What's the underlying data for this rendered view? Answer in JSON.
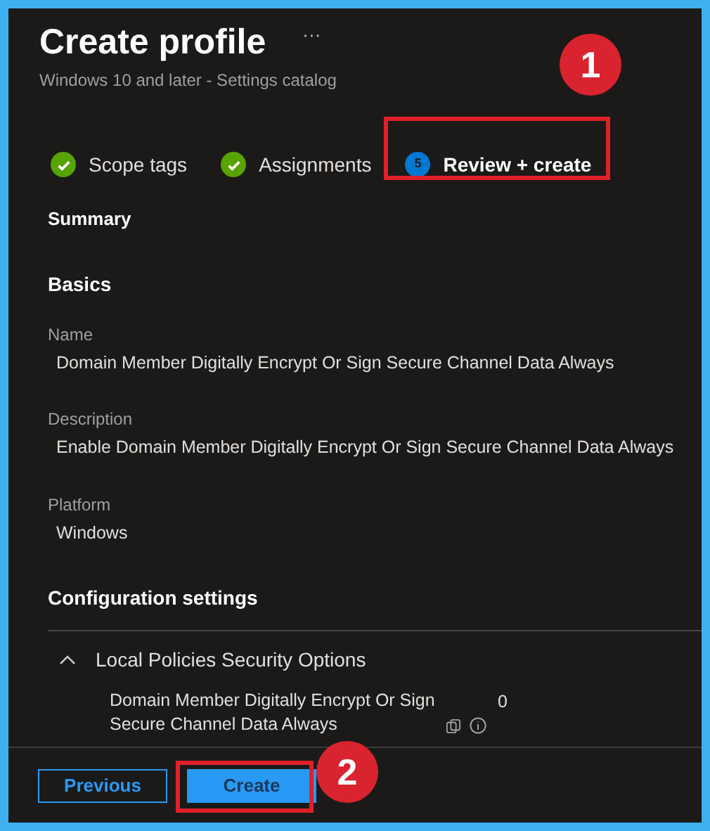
{
  "header": {
    "title": "Create profile",
    "more": "···",
    "subtitle": "Windows 10 and later - Settings catalog"
  },
  "steps": [
    {
      "label": "Scope tags",
      "completed": true,
      "selected": false
    },
    {
      "label": "Assignments",
      "completed": true,
      "selected": false
    },
    {
      "label": "Review + create",
      "number": "5",
      "completed": false,
      "selected": true
    }
  ],
  "summary": "Summary",
  "basics": {
    "heading": "Basics",
    "fields": [
      {
        "label": "Name",
        "value": "Domain Member Digitally Encrypt Or Sign Secure Channel Data Always"
      },
      {
        "label": "Description",
        "value": "Enable Domain Member Digitally Encrypt Or Sign Secure Channel Data Always"
      },
      {
        "label": "Platform",
        "value": "Windows"
      }
    ]
  },
  "configuration": {
    "heading": "Configuration settings",
    "groups": [
      {
        "title": "Local Policies Security Options",
        "expanded": true,
        "settings": [
          {
            "name": "Domain Member Digitally Encrypt Or Sign Secure Channel Data Always",
            "value": "0"
          }
        ]
      }
    ]
  },
  "footer": {
    "buttons": [
      {
        "label": "Previous",
        "kind": "secondary"
      },
      {
        "label": "Create",
        "kind": "primary"
      }
    ]
  },
  "callouts": [
    {
      "number": "1",
      "kind": "tab"
    },
    {
      "number": "2",
      "kind": "button"
    }
  ]
}
